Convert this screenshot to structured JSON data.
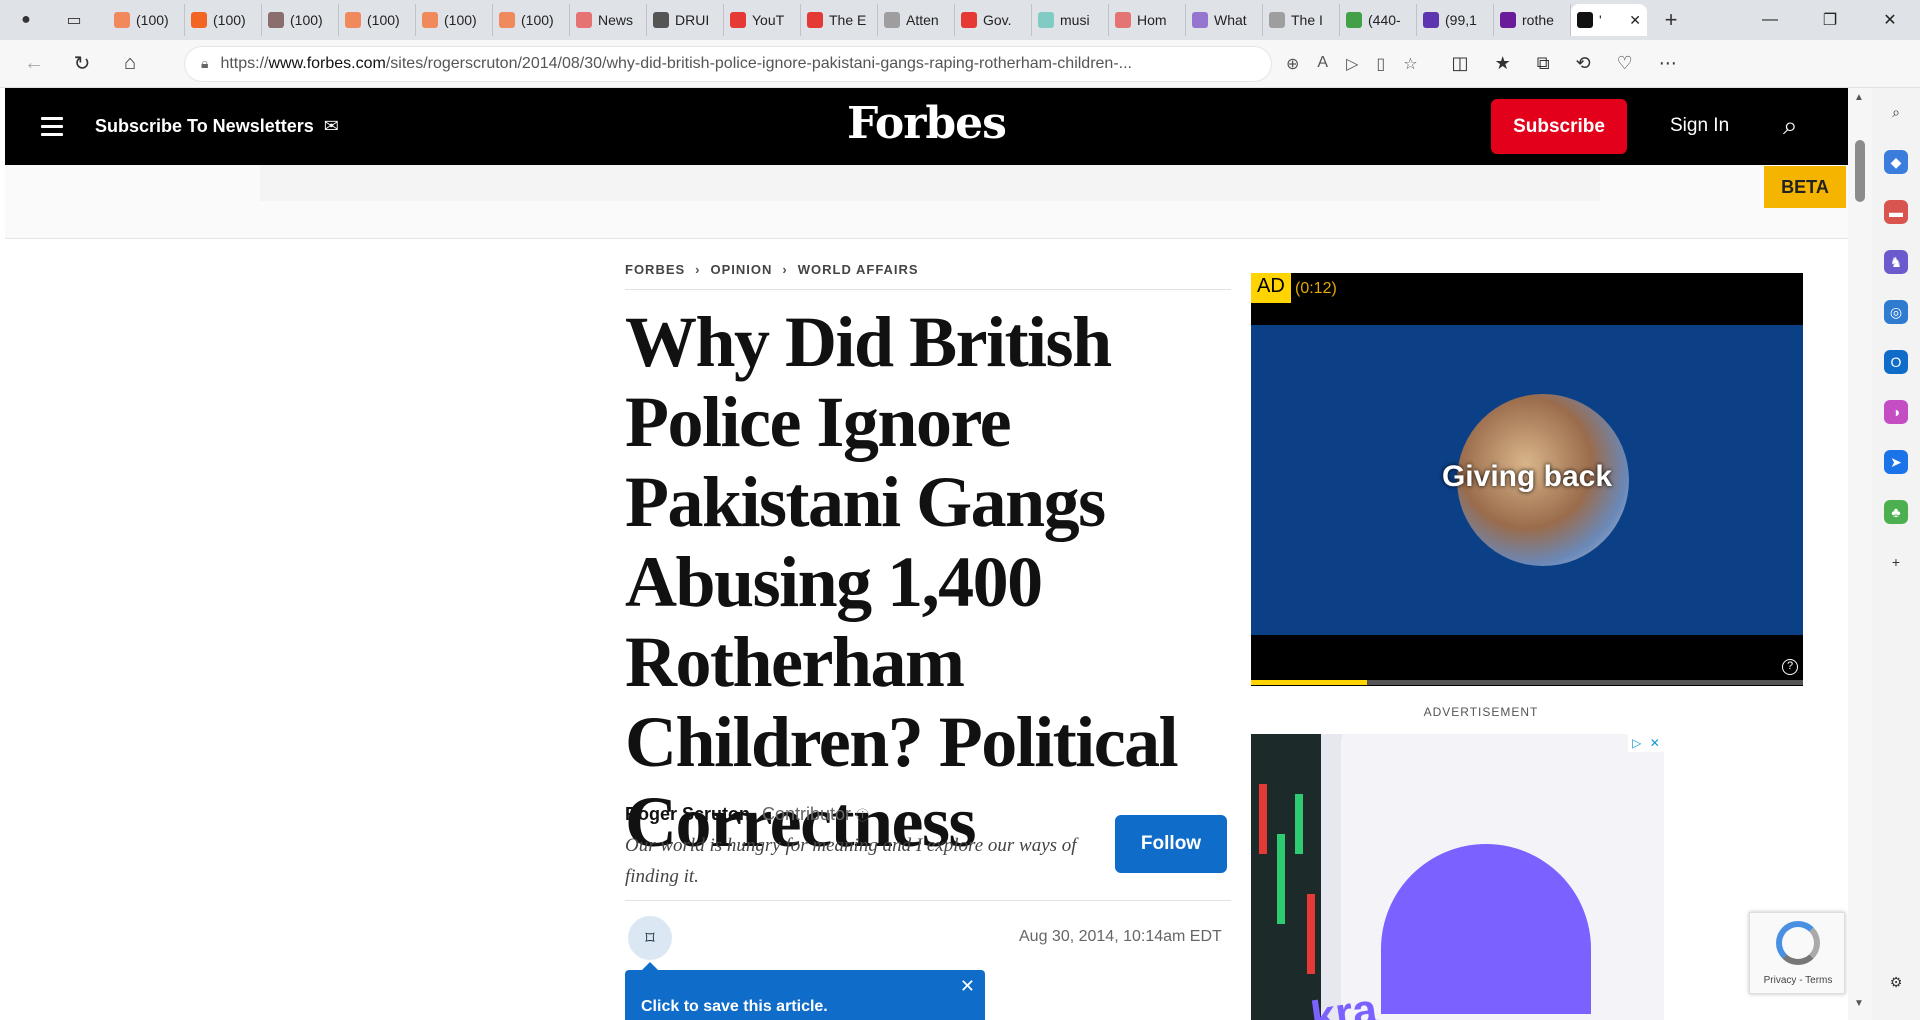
{
  "browser": {
    "tabs": [
      {
        "label": "(100)",
        "favicon_color": "#f08a5d"
      },
      {
        "label": "(100)",
        "favicon_color": "#f26522"
      },
      {
        "label": "(100)",
        "favicon_color": "#8a6d6d"
      },
      {
        "label": "(100)",
        "favicon_color": "#f08a5d"
      },
      {
        "label": "(100)",
        "favicon_color": "#f08a5d"
      },
      {
        "label": "(100)",
        "favicon_color": "#f08a5d"
      },
      {
        "label": "News",
        "favicon_color": "#e57373"
      },
      {
        "label": "DRUI",
        "favicon_color": "#555555"
      },
      {
        "label": "YouT",
        "favicon_color": "#e53935"
      },
      {
        "label": "The E",
        "favicon_color": "#e53935"
      },
      {
        "label": "Atten",
        "favicon_color": "#9e9e9e"
      },
      {
        "label": "Gov.",
        "favicon_color": "#e53935"
      },
      {
        "label": "musi",
        "favicon_color": "#80cbc4"
      },
      {
        "label": "Hom",
        "favicon_color": "#e57373"
      },
      {
        "label": "What",
        "favicon_color": "#9575cd"
      },
      {
        "label": "The I",
        "favicon_color": "#9e9e9e"
      },
      {
        "label": "(440-",
        "favicon_color": "#43a047"
      },
      {
        "label": "(99,1",
        "favicon_color": "#5e35b1"
      },
      {
        "label": "rothe",
        "favicon_color": "#6a1b9a"
      },
      {
        "label": "'",
        "favicon_color": "#111111"
      }
    ],
    "url_prefix": "https://",
    "url_domain": "www.forbes.com",
    "url_path": "/sites/rogerscruton/2014/08/30/why-did-british-police-ignore-pakistani-gangs-raping-rotherham-children-..."
  },
  "header": {
    "newsletter_label": "Subscribe To Newsletters",
    "logo": "Forbes",
    "subscribe_label": "Subscribe",
    "signin_label": "Sign In",
    "beta_label": "BETA"
  },
  "article": {
    "breadcrumbs": [
      "FORBES",
      "OPINION",
      "WORLD AFFAIRS"
    ],
    "headline": "Why Did British Police Ignore Pakistani Gangs Abusing 1,400 Rotherham Children? Political Correctness",
    "author": "Roger Scruton",
    "author_role": "Contributor",
    "bio": "Our world is hungry for meaning and I explore our ways of finding it.",
    "follow_label": "Follow",
    "date": "Aug 30, 2014, 10:14am EDT",
    "save_tip": "Click to save this article."
  },
  "ads": {
    "video_ad_label": "AD",
    "video_timer": "(0:12)",
    "video_text": "Giving back",
    "video_progress": 0.21,
    "advertisement_label": "ADVERTISEMENT",
    "kraken_text": "kra"
  },
  "recaptcha": {
    "links": "Privacy - Terms"
  }
}
